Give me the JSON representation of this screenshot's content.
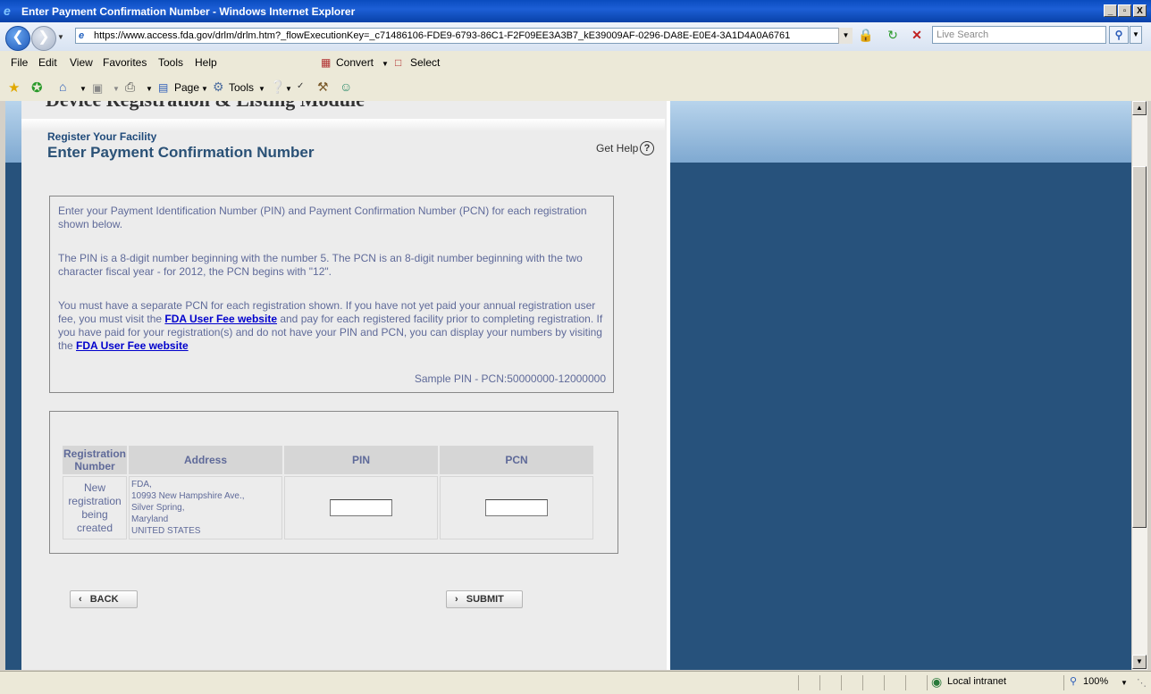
{
  "window": {
    "title": "Enter Payment Confirmation Number - Windows Internet Explorer",
    "minimize": "_",
    "restore": "▫",
    "close": "X"
  },
  "addressbar": {
    "url": "https://www.access.fda.gov/drlm/drlm.htm?_flowExecutionKey=_c71486106-FDE9-6793-86C1-F2F09EE3A3B7_kE39009AF-0296-DA8E-E0E4-3A1D4A0A6761",
    "search_placeholder": "Live Search"
  },
  "menubar": {
    "items": [
      "File",
      "Edit",
      "View",
      "Favorites",
      "Tools",
      "Help"
    ],
    "convert": "Convert",
    "select": "Select"
  },
  "commandbar": {
    "page": "Page",
    "tools": "Tools"
  },
  "page": {
    "cut_heading": "Device Registration & Listing Module",
    "section": "Register Your Facility",
    "title": "Enter Payment Confirmation Number",
    "get_help": "Get Help",
    "info": {
      "p1": "Enter your Payment Identification Number (PIN) and Payment Confirmation Number (PCN) for each registration shown below.",
      "p2": "The PIN is a 8-digit number beginning with the number 5. The PCN is an 8-digit number beginning with the two character fiscal year - for 2012, the PCN begins with \"12\".",
      "p3_a": "You must have a separate PCN for each registration shown. If you have not yet paid your annual registration user fee, you must visit the ",
      "p3_link1": "FDA User Fee website",
      "p3_b": " and pay for each registered facility prior to completing registration. If you have paid for your registration(s) and do not have your PIN and PCN, you can display your numbers by visiting the ",
      "p3_link2": "FDA User Fee website",
      "sample": "Sample PIN - PCN:50000000-12000000"
    },
    "table": {
      "headers": [
        "Registration Number",
        "Address",
        "PIN",
        "PCN"
      ],
      "row": {
        "registration": "New registration being created",
        "address": [
          "FDA,",
          "10993 New Hampshire Ave.,",
          "Silver Spring,",
          "Maryland",
          "UNITED STATES"
        ],
        "pin": "",
        "pcn": ""
      }
    },
    "back": "BACK",
    "submit": "SUBMIT"
  },
  "statusbar": {
    "zone": "Local intranet",
    "zoom": "100%"
  }
}
